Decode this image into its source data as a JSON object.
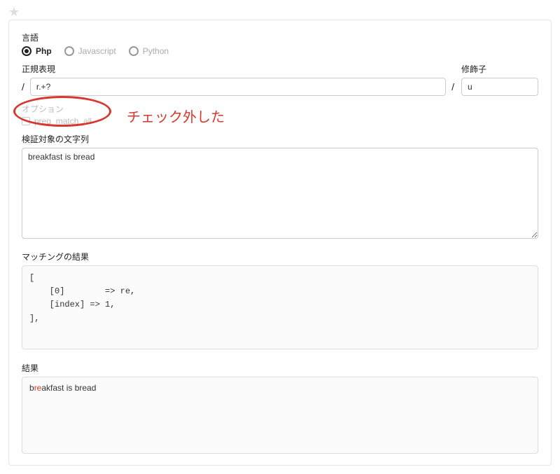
{
  "star_glyph": "★",
  "lang": {
    "label": "言語",
    "options": [
      {
        "label": "Php",
        "checked": true
      },
      {
        "label": "Javascript",
        "checked": false
      },
      {
        "label": "Python",
        "checked": false
      }
    ]
  },
  "regex": {
    "label": "正規表現",
    "value": "r.+?",
    "slash": "/"
  },
  "modifiers": {
    "label": "修飾子",
    "value": "u"
  },
  "options": {
    "label": "オプション",
    "checkbox_label": "preg_match_all",
    "checked": false
  },
  "annotation": "チェック外した",
  "target": {
    "label": "検証対象の文字列",
    "value": "breakfast is bread"
  },
  "match_result": {
    "label": "マッチングの結果",
    "lines": [
      "[",
      "    [0]        => re,",
      "    [index] => 1,",
      "],"
    ]
  },
  "final_result": {
    "label": "結果",
    "prefix": "b",
    "highlight": "re",
    "suffix": "akfast is bread"
  }
}
